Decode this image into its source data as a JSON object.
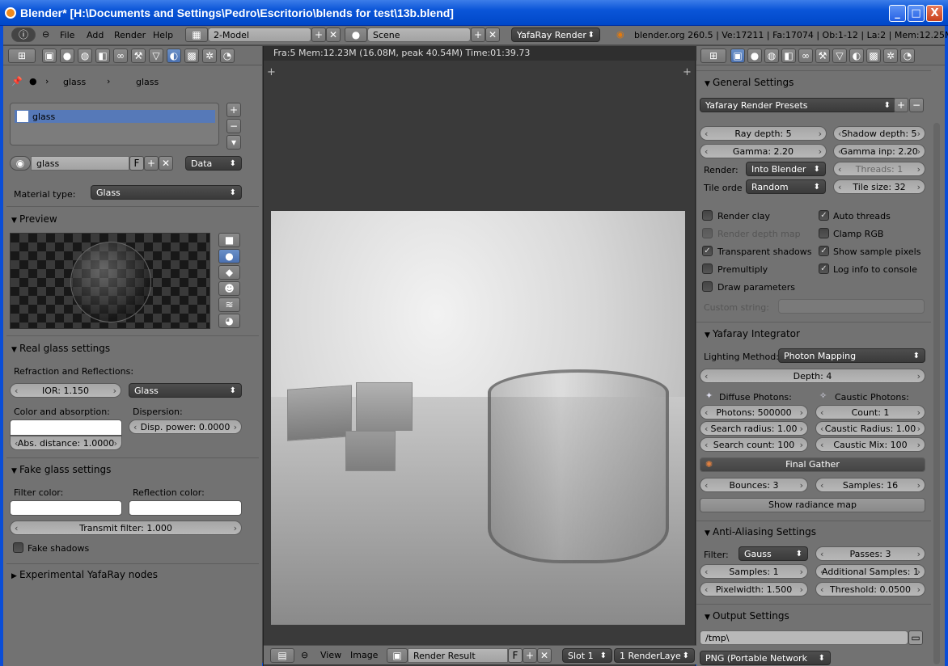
{
  "window": {
    "title": "Blender* [H:\\Documents and Settings\\Pedro\\Escritorio\\blends for test\\13b.blend]",
    "minimize": "_",
    "maximize": "□",
    "close": "X"
  },
  "menubar": {
    "menus": [
      "File",
      "Add",
      "Render",
      "Help"
    ],
    "layout": "2-Model",
    "scene": "Scene",
    "engine": "YafaRay Render",
    "stats": "blender.org 260.5 | Ve:17211 | Fa:17074 | Ob:1-12 | La:2 | Mem:12.25M (0"
  },
  "left": {
    "breadcrumb": [
      "glass",
      "glass"
    ],
    "slot": "glass",
    "material_name": "glass",
    "f": "F",
    "data_mode": "Data",
    "material_type_label": "Material type:",
    "material_type": "Glass",
    "preview_header": "Preview",
    "real_glass": {
      "header": "Real glass settings",
      "refr_label": "Refraction and Reflections:",
      "ior": "IOR: 1.150",
      "preset": "Glass",
      "color_label": "Color and absorption:",
      "dispersion_label": "Dispersion:",
      "disp_power": "Disp. power: 0.0000",
      "abs_distance": "Abs. distance: 1.0000"
    },
    "fake_glass": {
      "header": "Fake glass settings",
      "filter_label": "Filter color:",
      "reflection_label": "Reflection color:",
      "transmit": "Transmit filter: 1.000",
      "fake_shadows": "Fake shadows"
    },
    "experimental": "Experimental YafaRay nodes"
  },
  "center": {
    "info": "Fra:5  Mem:12.23M (16.08M, peak 40.54M) Time:01:39.73",
    "footer": {
      "view": "View",
      "image": "Image",
      "result": "Render Result",
      "f": "F",
      "slot": "Slot 1",
      "layer": "1 RenderLaye"
    }
  },
  "right": {
    "general": {
      "header": "General Settings",
      "presets": "Yafaray Render Presets",
      "ray_depth": "Ray depth: 5",
      "shadow_depth": "Shadow depth: 5",
      "gamma": "Gamma: 2.20",
      "gamma_inp": "Gamma inp: 2.20",
      "render_label": "Render:",
      "render_value": "Into Blender",
      "threads": "Threads: 1",
      "tile_label": "Tile orde",
      "tile_value": "Random",
      "tile_size": "Tile size: 32",
      "checks": [
        {
          "label": "Render clay",
          "on": false,
          "dim": false
        },
        {
          "label": "Auto threads",
          "on": true,
          "dim": false
        },
        {
          "label": "Render depth map",
          "on": false,
          "dim": true
        },
        {
          "label": "Clamp RGB",
          "on": false,
          "dim": false
        },
        {
          "label": "Transparent shadows",
          "on": true,
          "dim": false
        },
        {
          "label": "Show sample pixels",
          "on": true,
          "dim": false
        },
        {
          "label": "Premultiply",
          "on": false,
          "dim": false
        },
        {
          "label": "Log info to console",
          "on": true,
          "dim": false
        },
        {
          "label": "Draw parameters",
          "on": false,
          "dim": false
        }
      ],
      "custom_string": "Custom string:"
    },
    "integrator": {
      "header": "Yafaray Integrator",
      "method_label": "Lighting Method:",
      "method": "Photon Mapping",
      "depth": "Depth: 4",
      "diffuse_label": "Diffuse Photons:",
      "caustic_label": "Caustic Photons:",
      "photons": "Photons: 500000",
      "count": "Count: 1",
      "search_radius": "Search radius: 1.00",
      "caustic_radius": "Caustic Radius: 1.00",
      "search_count": "Search count: 100",
      "caustic_mix": "Caustic Mix: 100",
      "final_gather": "Final Gather",
      "bounces": "Bounces: 3",
      "samples": "Samples: 16",
      "show_radiance": "Show radiance map"
    },
    "aa": {
      "header": "Anti-Aliasing Settings",
      "filter_label": "Filter:",
      "filter": "Gauss",
      "passes": "Passes: 3",
      "samples": "Samples: 1",
      "additional": "Additional Samples: 1",
      "pixelwidth": "Pixelwidth: 1.500",
      "threshold": "Threshold: 0.0500"
    },
    "output": {
      "header": "Output Settings",
      "path": "/tmp\\",
      "format": "PNG (Portable Network"
    }
  }
}
